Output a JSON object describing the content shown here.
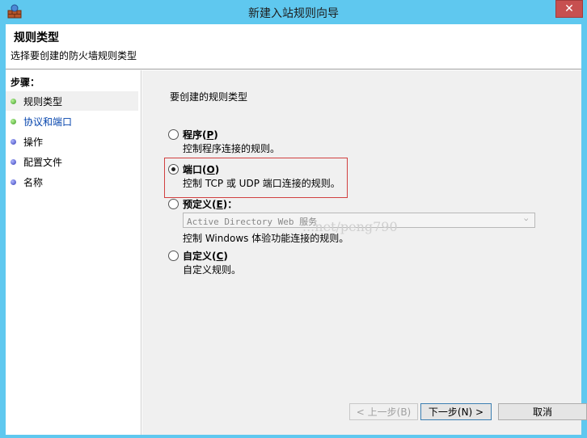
{
  "window": {
    "title": "新建入站规则向导",
    "close_glyph": "✕"
  },
  "header": {
    "title": "规则类型",
    "subtitle": "选择要创建的防火墙规则类型"
  },
  "sidebar": {
    "title": "步骤：",
    "steps": [
      {
        "label": "规则类型",
        "state": "done"
      },
      {
        "label": "协议和端口",
        "state": "current"
      },
      {
        "label": "操作",
        "state": "pending"
      },
      {
        "label": "配置文件",
        "state": "pending"
      },
      {
        "label": "名称",
        "state": "pending"
      }
    ]
  },
  "main": {
    "question": "要创建的规则类型",
    "options": [
      {
        "label": "程序(",
        "key": "P",
        "suffix": ")",
        "desc": "控制程序连接的规则。",
        "checked": false
      },
      {
        "label": "端口(",
        "key": "O",
        "suffix": ")",
        "desc": "控制 TCP 或 UDP 端口连接的规则。",
        "checked": true
      },
      {
        "label": "预定义(",
        "key": "E",
        "suffix": ")：",
        "desc": "控制 Windows 体验功能连接的规则。",
        "checked": false
      },
      {
        "label": "自定义(",
        "key": "C",
        "suffix": ")",
        "desc": "自定义规则。",
        "checked": false
      }
    ],
    "predefined_select_value": "Active Directory Web 服务",
    "watermark": "...net/peng790"
  },
  "buttons": {
    "back": "< 上一步(B)",
    "next": "下一步(N) >",
    "cancel": "取消"
  },
  "colors": {
    "titlebar": "#5fc8ef",
    "close": "#c75050",
    "highlight": "#d14040"
  }
}
